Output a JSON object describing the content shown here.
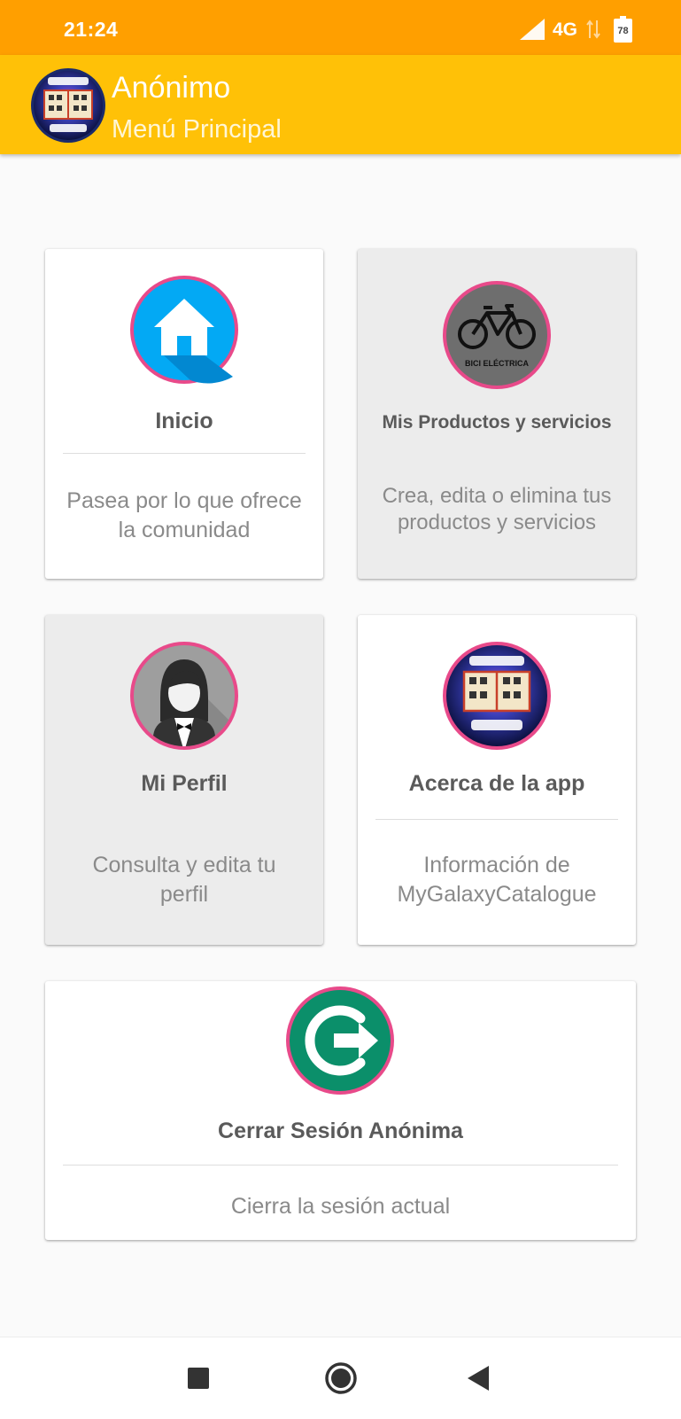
{
  "status_bar": {
    "time": "21:24",
    "network": "4G",
    "battery": "78",
    "background": "#ff9f00",
    "icons": [
      "signal-icon",
      "data-arrows-icon",
      "battery-icon"
    ]
  },
  "app_bar": {
    "title": "Anónimo",
    "subtitle": "Menú Principal",
    "background": "#ffc107",
    "logo": "my-galaxy-catalogue-logo"
  },
  "cards": [
    {
      "title": "Inicio",
      "description_lines": [
        "Pasea por lo que ofrece",
        "la comunidad"
      ],
      "icon": "home-icon",
      "background": "#ffffff"
    },
    {
      "title": "Mis Productos y servicios",
      "description_lines": [
        "Crea, edita o elimina tus",
        "productos y servicios"
      ],
      "icon": "bicycle-icon",
      "icon_caption": "BICI ELÉCTRICA",
      "background": "#ececec"
    },
    {
      "title": "Mi Perfil",
      "description_lines": [
        "Consulta y edita tu",
        "perfil"
      ],
      "icon": "profile-avatar-icon",
      "background": "#ececec"
    },
    {
      "title": "Acerca de la app",
      "description_lines": [
        "Información de",
        "MyGalaxyCatalogue"
      ],
      "icon": "app-logo-icon",
      "background": "#ffffff"
    },
    {
      "title": "Cerrar Sesión Anónima",
      "description_lines": [
        "Cierra la sesión actual"
      ],
      "icon": "logout-icon",
      "background": "#ffffff"
    }
  ],
  "colors": {
    "icon_ring": "#e84a8a",
    "home_bg": "#03a9f4",
    "logout_bg": "#0b8f6a",
    "text_title": "#5a5a5a",
    "text_desc": "#8a8a8a"
  },
  "nav_bar": {
    "buttons": [
      "recents-square-icon",
      "home-circle-icon",
      "back-triangle-icon"
    ]
  }
}
